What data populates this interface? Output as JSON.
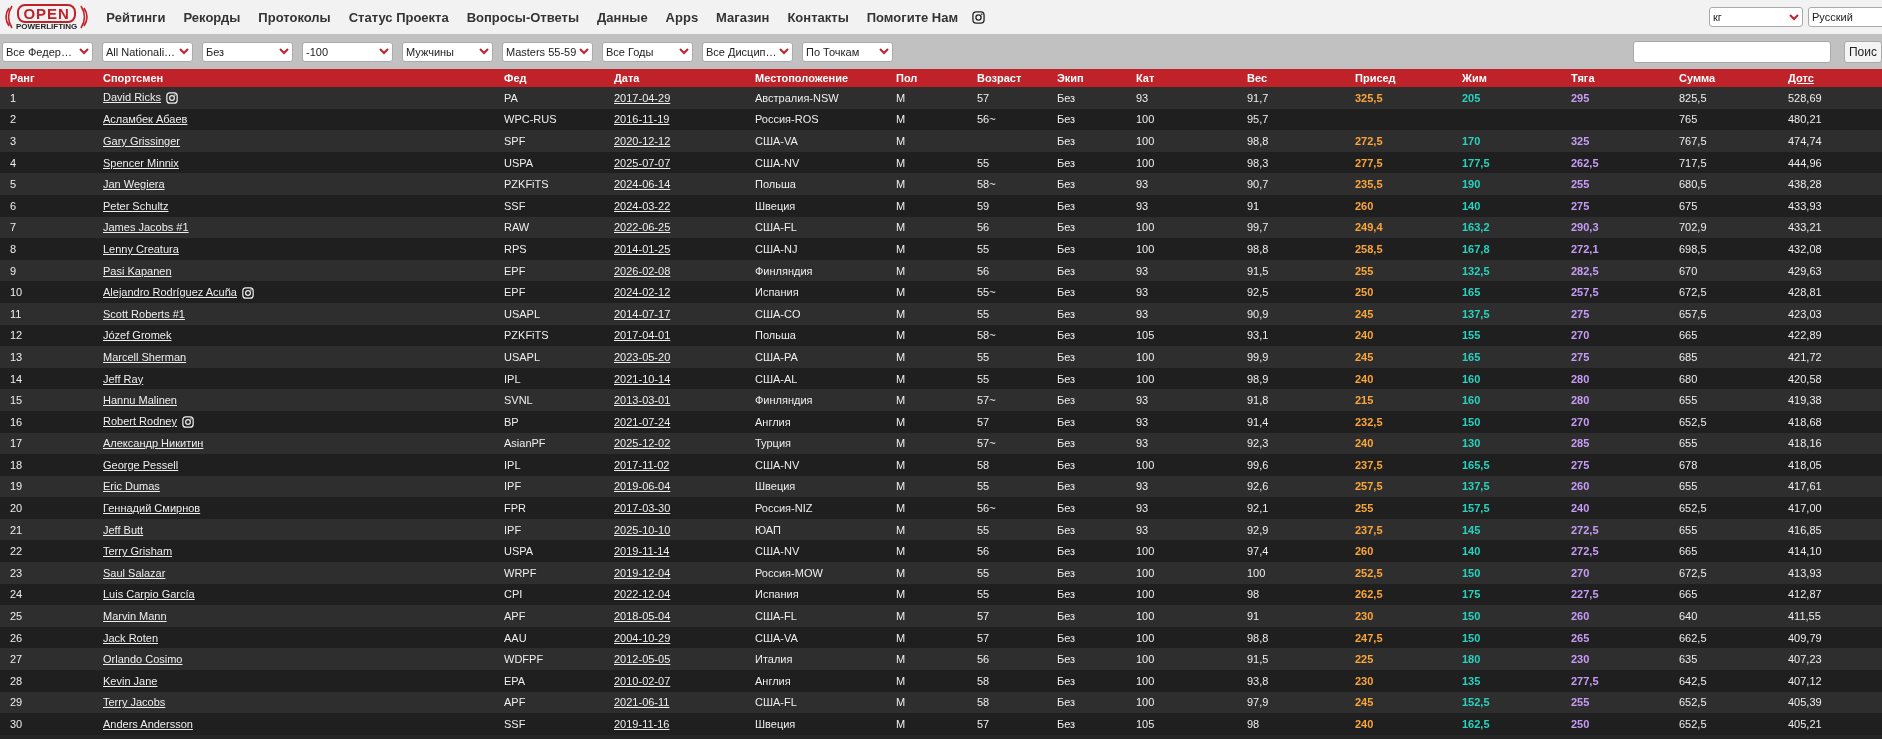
{
  "logo": {
    "title": "OPEN",
    "subtitle": "POWERLIFTING"
  },
  "nav": [
    "Рейтинги",
    "Рекорды",
    "Протоколы",
    "Статус Проекта",
    "Вопросы-Ответы",
    "Данные",
    "Apps",
    "Магазин",
    "Контакты",
    "Помогите Нам"
  ],
  "unit_select": "кг",
  "language_select": "Русский",
  "filters": [
    "Все Федер…",
    "All Nationali…",
    "Без",
    "-100",
    "Мужчины",
    "Masters 55-59",
    "Все Годы",
    "Все Дисцип…",
    "По Точкам"
  ],
  "search": {
    "button": "Поис"
  },
  "columns": [
    {
      "label": "Ранг",
      "sorted": false
    },
    {
      "label": "Спортсмен",
      "sorted": false
    },
    {
      "label": "Фед",
      "sorted": false
    },
    {
      "label": "Дата",
      "sorted": false
    },
    {
      "label": "Местоположение",
      "sorted": false
    },
    {
      "label": "Пол",
      "sorted": false
    },
    {
      "label": "Возраст",
      "sorted": false
    },
    {
      "label": "Экип",
      "sorted": false
    },
    {
      "label": "Кат",
      "sorted": false
    },
    {
      "label": "Вес",
      "sorted": false
    },
    {
      "label": "Присед",
      "sorted": false
    },
    {
      "label": "Жим",
      "sorted": false
    },
    {
      "label": "Тяга",
      "sorted": false
    },
    {
      "label": "Сумма",
      "sorted": false
    },
    {
      "label": "Дотс",
      "sorted": true
    }
  ],
  "rows": [
    {
      "rank": "1",
      "name": "David Ricks",
      "instagram": true,
      "fed": "PA",
      "date": "2017-04-29",
      "location": "Австралия-NSW",
      "sex": "M",
      "age": "57",
      "equip": "Без",
      "class": "93",
      "weight": "91,7",
      "squat": "325,5",
      "bench": "205",
      "deadlift": "295",
      "total": "825,5",
      "dots": "528,69"
    },
    {
      "rank": "2",
      "name": "Асламбек Абаев",
      "instagram": false,
      "fed": "WPC-RUS",
      "date": "2016-11-19",
      "location": "Россия-ROS",
      "sex": "M",
      "age": "56~",
      "equip": "Без",
      "class": "100",
      "weight": "95,7",
      "total": "765",
      "dots": "480,21"
    },
    {
      "rank": "3",
      "name": "Gary Grissinger",
      "instagram": false,
      "fed": "SPF",
      "date": "2020-12-12",
      "location": "США-VA",
      "sex": "M",
      "equip": "Без",
      "class": "100",
      "weight": "98,8",
      "squat": "272,5",
      "bench": "170",
      "deadlift": "325",
      "total": "767,5",
      "dots": "474,74"
    },
    {
      "rank": "4",
      "name": "Spencer Minnix",
      "instagram": false,
      "fed": "USPA",
      "date": "2025-07-07",
      "location": "США-NV",
      "sex": "M",
      "age": "55",
      "equip": "Без",
      "class": "100",
      "weight": "98,3",
      "squat": "277,5",
      "bench": "177,5",
      "deadlift": "262,5",
      "total": "717,5",
      "dots": "444,96"
    },
    {
      "rank": "5",
      "name": "Jan Wegiera",
      "instagram": false,
      "fed": "PZKFiTS",
      "date": "2024-06-14",
      "location": "Польша",
      "sex": "M",
      "age": "58~",
      "equip": "Без",
      "class": "93",
      "weight": "90,7",
      "squat": "235,5",
      "bench": "190",
      "deadlift": "255",
      "total": "680,5",
      "dots": "438,28"
    },
    {
      "rank": "6",
      "name": "Peter Schultz",
      "instagram": false,
      "fed": "SSF",
      "date": "2024-03-22",
      "location": "Швеция",
      "sex": "M",
      "age": "59",
      "equip": "Без",
      "class": "93",
      "weight": "91",
      "squat": "260",
      "bench": "140",
      "deadlift": "275",
      "total": "675",
      "dots": "433,93"
    },
    {
      "rank": "7",
      "name": "James Jacobs #1",
      "instagram": false,
      "fed": "RAW",
      "date": "2022-06-25",
      "location": "США-FL",
      "sex": "M",
      "age": "56",
      "equip": "Без",
      "class": "100",
      "weight": "99,7",
      "squat": "249,4",
      "bench": "163,2",
      "deadlift": "290,3",
      "total": "702,9",
      "dots": "433,21"
    },
    {
      "rank": "8",
      "name": "Lenny Creatura",
      "instagram": false,
      "fed": "RPS",
      "date": "2014-01-25",
      "location": "США-NJ",
      "sex": "M",
      "age": "55",
      "equip": "Без",
      "class": "100",
      "weight": "98,8",
      "squat": "258,5",
      "bench": "167,8",
      "deadlift": "272,1",
      "total": "698,5",
      "dots": "432,08"
    },
    {
      "rank": "9",
      "name": "Pasi Kapanen",
      "instagram": false,
      "fed": "EPF",
      "date": "2026-02-08",
      "location": "Финляндия",
      "sex": "M",
      "age": "56",
      "equip": "Без",
      "class": "93",
      "weight": "91,5",
      "squat": "255",
      "bench": "132,5",
      "deadlift": "282,5",
      "total": "670",
      "dots": "429,63"
    },
    {
      "rank": "10",
      "name": "Alejandro Rodríguez Acuña",
      "instagram": true,
      "fed": "EPF",
      "date": "2024-02-12",
      "location": "Испания",
      "sex": "M",
      "age": "55~",
      "equip": "Без",
      "class": "93",
      "weight": "92,5",
      "squat": "250",
      "bench": "165",
      "deadlift": "257,5",
      "total": "672,5",
      "dots": "428,81"
    },
    {
      "rank": "11",
      "name": "Scott Roberts #1",
      "instagram": false,
      "fed": "USAPL",
      "date": "2014-07-17",
      "location": "США-CO",
      "sex": "M",
      "age": "55",
      "equip": "Без",
      "class": "93",
      "weight": "90,9",
      "squat": "245",
      "bench": "137,5",
      "deadlift": "275",
      "total": "657,5",
      "dots": "423,03"
    },
    {
      "rank": "12",
      "name": "Józef Gromek",
      "instagram": false,
      "fed": "PZKFiTS",
      "date": "2017-04-01",
      "location": "Польша",
      "sex": "M",
      "age": "58~",
      "equip": "Без",
      "class": "105",
      "weight": "93,1",
      "squat": "240",
      "bench": "155",
      "deadlift": "270",
      "total": "665",
      "dots": "422,89"
    },
    {
      "rank": "13",
      "name": "Marcell Sherman",
      "instagram": false,
      "fed": "USAPL",
      "date": "2023-05-20",
      "location": "США-PA",
      "sex": "M",
      "age": "55",
      "equip": "Без",
      "class": "100",
      "weight": "99,9",
      "squat": "245",
      "bench": "165",
      "deadlift": "275",
      "total": "685",
      "dots": "421,72"
    },
    {
      "rank": "14",
      "name": "Jeff Ray",
      "instagram": false,
      "fed": "IPL",
      "date": "2021-10-14",
      "location": "США-AL",
      "sex": "M",
      "age": "55",
      "equip": "Без",
      "class": "100",
      "weight": "98,9",
      "squat": "240",
      "bench": "160",
      "deadlift": "280",
      "total": "680",
      "dots": "420,58"
    },
    {
      "rank": "15",
      "name": "Hannu Malinen",
      "instagram": false,
      "fed": "SVNL",
      "date": "2013-03-01",
      "location": "Финляндия",
      "sex": "M",
      "age": "57~",
      "equip": "Без",
      "class": "93",
      "weight": "91,8",
      "squat": "215",
      "bench": "160",
      "deadlift": "280",
      "total": "655",
      "dots": "419,38"
    },
    {
      "rank": "16",
      "name": "Robert Rodney",
      "instagram": true,
      "fed": "BP",
      "date": "2021-07-24",
      "location": "Англия",
      "sex": "M",
      "age": "57",
      "equip": "Без",
      "class": "93",
      "weight": "91,4",
      "squat": "232,5",
      "bench": "150",
      "deadlift": "270",
      "total": "652,5",
      "dots": "418,68"
    },
    {
      "rank": "17",
      "name": "Александр Никитин",
      "instagram": false,
      "fed": "AsianPF",
      "date": "2025-12-02",
      "location": "Турция",
      "sex": "M",
      "age": "57~",
      "equip": "Без",
      "class": "93",
      "weight": "92,3",
      "squat": "240",
      "bench": "130",
      "deadlift": "285",
      "total": "655",
      "dots": "418,16"
    },
    {
      "rank": "18",
      "name": "George Pessell",
      "instagram": false,
      "fed": "IPL",
      "date": "2017-11-02",
      "location": "США-NV",
      "sex": "M",
      "age": "58",
      "equip": "Без",
      "class": "100",
      "weight": "99,6",
      "squat": "237,5",
      "bench": "165,5",
      "deadlift": "275",
      "total": "678",
      "dots": "418,05"
    },
    {
      "rank": "19",
      "name": "Eric Dumas",
      "instagram": false,
      "fed": "IPF",
      "date": "2019-06-04",
      "location": "Швеция",
      "sex": "M",
      "age": "55",
      "equip": "Без",
      "class": "93",
      "weight": "92,6",
      "squat": "257,5",
      "bench": "137,5",
      "deadlift": "260",
      "total": "655",
      "dots": "417,61"
    },
    {
      "rank": "20",
      "name": "Геннадий Смирнов",
      "instagram": false,
      "fed": "FPR",
      "date": "2017-03-30",
      "location": "Россия-NIZ",
      "sex": "M",
      "age": "56~",
      "equip": "Без",
      "class": "93",
      "weight": "92,1",
      "squat": "255",
      "bench": "157,5",
      "deadlift": "240",
      "total": "652,5",
      "dots": "417,00"
    },
    {
      "rank": "21",
      "name": "Jeff Butt",
      "instagram": false,
      "fed": "IPF",
      "date": "2025-10-10",
      "location": "ЮАП",
      "sex": "M",
      "age": "55",
      "equip": "Без",
      "class": "93",
      "weight": "92,9",
      "squat": "237,5",
      "bench": "145",
      "deadlift": "272,5",
      "total": "655",
      "dots": "416,85"
    },
    {
      "rank": "22",
      "name": "Terry Grisham",
      "instagram": false,
      "fed": "USPA",
      "date": "2019-11-14",
      "location": "США-NV",
      "sex": "M",
      "age": "56",
      "equip": "Без",
      "class": "100",
      "weight": "97,4",
      "squat": "260",
      "bench": "140",
      "deadlift": "272,5",
      "total": "665",
      "dots": "414,10"
    },
    {
      "rank": "23",
      "name": "Saul Salazar",
      "instagram": false,
      "fed": "WRPF",
      "date": "2019-12-04",
      "location": "Россия-MOW",
      "sex": "M",
      "age": "55",
      "equip": "Без",
      "class": "100",
      "weight": "100",
      "squat": "252,5",
      "bench": "150",
      "deadlift": "270",
      "total": "672,5",
      "dots": "413,93"
    },
    {
      "rank": "24",
      "name": "Luis Carpio García",
      "instagram": false,
      "fed": "CPI",
      "date": "2022-12-04",
      "location": "Испания",
      "sex": "M",
      "age": "55",
      "equip": "Без",
      "class": "100",
      "weight": "98",
      "squat": "262,5",
      "bench": "175",
      "deadlift": "227,5",
      "total": "665",
      "dots": "412,87"
    },
    {
      "rank": "25",
      "name": "Marvin Mann",
      "instagram": false,
      "fed": "APF",
      "date": "2018-05-04",
      "location": "США-FL",
      "sex": "M",
      "age": "57",
      "equip": "Без",
      "class": "100",
      "weight": "91",
      "squat": "230",
      "bench": "150",
      "deadlift": "260",
      "total": "640",
      "dots": "411,55"
    },
    {
      "rank": "26",
      "name": "Jack Roten",
      "instagram": false,
      "fed": "AAU",
      "date": "2004-10-29",
      "location": "США-VA",
      "sex": "M",
      "age": "57",
      "equip": "Без",
      "class": "100",
      "weight": "98,8",
      "squat": "247,5",
      "bench": "150",
      "deadlift": "265",
      "total": "662,5",
      "dots": "409,79"
    },
    {
      "rank": "27",
      "name": "Orlando Cosimo",
      "instagram": false,
      "fed": "WDFPF",
      "date": "2012-05-05",
      "location": "Италия",
      "sex": "M",
      "age": "56",
      "equip": "Без",
      "class": "100",
      "weight": "91,5",
      "squat": "225",
      "bench": "180",
      "deadlift": "230",
      "total": "635",
      "dots": "407,23"
    },
    {
      "rank": "28",
      "name": "Kevin Jane",
      "instagram": false,
      "fed": "EPA",
      "date": "2010-02-07",
      "location": "Англия",
      "sex": "M",
      "age": "58",
      "equip": "Без",
      "class": "100",
      "weight": "93,8",
      "squat": "230",
      "bench": "135",
      "deadlift": "277,5",
      "total": "642,5",
      "dots": "407,12"
    },
    {
      "rank": "29",
      "name": "Terry Jacobs",
      "instagram": false,
      "fed": "APF",
      "date": "2021-06-11",
      "location": "США-FL",
      "sex": "M",
      "age": "58",
      "equip": "Без",
      "class": "100",
      "weight": "97,9",
      "squat": "245",
      "bench": "152,5",
      "deadlift": "255",
      "total": "652,5",
      "dots": "405,39"
    },
    {
      "rank": "30",
      "name": "Anders Andersson",
      "instagram": false,
      "fed": "SSF",
      "date": "2019-11-16",
      "location": "Швеция",
      "sex": "M",
      "age": "57",
      "equip": "Без",
      "class": "105",
      "weight": "98",
      "squat": "240",
      "bench": "162,5",
      "deadlift": "250",
      "total": "652,5",
      "dots": "405,21"
    }
  ]
}
